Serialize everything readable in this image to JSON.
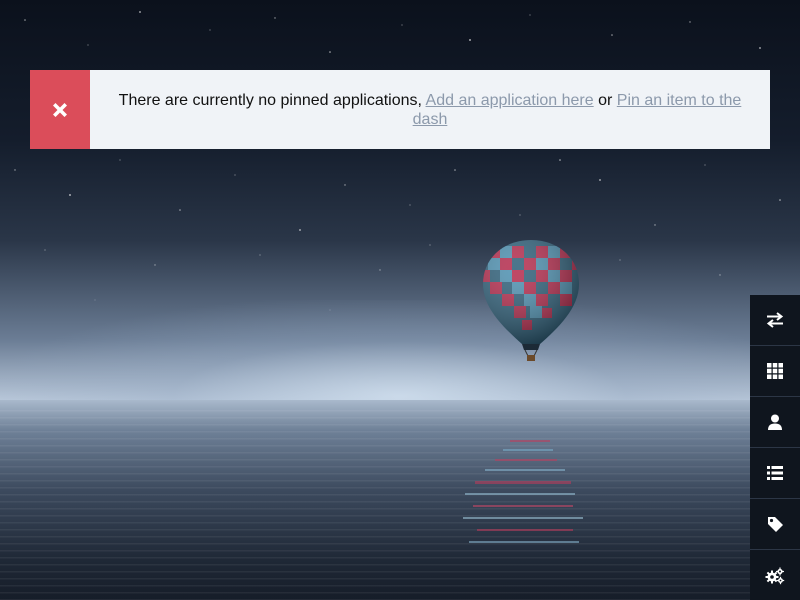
{
  "alert": {
    "icon": "close-icon",
    "color": "#db4d5a",
    "message": "There are currently no pinned applications,",
    "link_add": "Add an application here",
    "separator": "or",
    "link_pin": "Pin an item to the dash"
  },
  "sidebar": {
    "items": [
      {
        "icon": "swap-arrows-icon"
      },
      {
        "icon": "grid-icon"
      },
      {
        "icon": "user-icon"
      },
      {
        "icon": "list-icon"
      },
      {
        "icon": "tag-icon"
      },
      {
        "icon": "gears-icon"
      }
    ]
  }
}
